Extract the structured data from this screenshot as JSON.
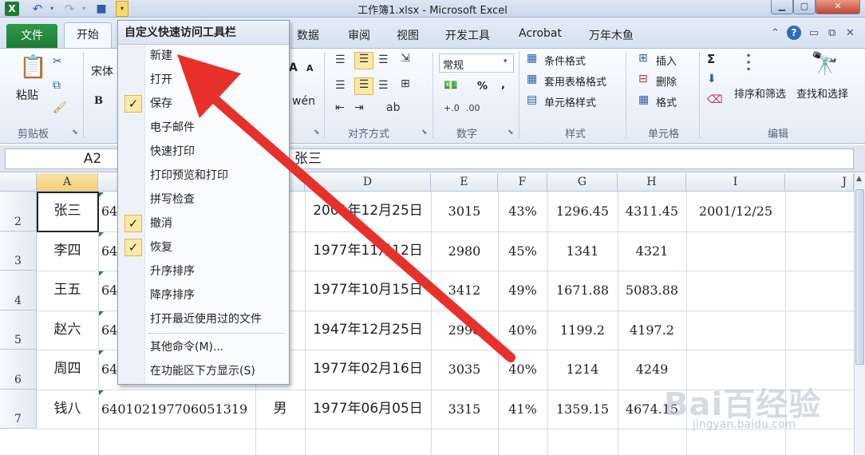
{
  "titlebar": {
    "title": "工作簿1.xlsx  -  Microsoft Excel",
    "icons": [
      "excel-logo",
      "undo-icon",
      "redo-icon",
      "save-icon",
      "customize-dropdown-icon"
    ],
    "window_buttons": {
      "min": "▁",
      "max": "▢",
      "close": "✕"
    }
  },
  "tabs": {
    "file": "文件",
    "home": "开始",
    "others": [
      "数据",
      "审阅",
      "视图",
      "开发工具",
      "Acrobat",
      "万年木鱼"
    ]
  },
  "ribbon": {
    "clipboard": {
      "paste": "粘贴",
      "label": "剪贴板"
    },
    "font": {
      "font_name": "宋体",
      "bold": "B",
      "grow": "A",
      "shrink": "A",
      "phonetic": "wén"
    },
    "alignment": {
      "label": "对齐方式"
    },
    "number": {
      "format": "常规",
      "percent": "%",
      "comma": ",",
      "label": "数字"
    },
    "styles": {
      "conditional": "条件格式",
      "table": "套用表格格式",
      "cell_styles": "单元格样式",
      "label": "样式"
    },
    "cells": {
      "insert": "插入",
      "delete": "删除",
      "format": "格式",
      "label": "单元格"
    },
    "editing": {
      "sigma": "Σ",
      "sort_filter": "排序和筛选",
      "find_select": "查找和选择",
      "label": "编辑"
    }
  },
  "formula_bar": {
    "name_box": "A2",
    "formula": "张三"
  },
  "grid": {
    "columns": [
      "A",
      "B",
      "C",
      "D",
      "E",
      "F",
      "G",
      "H",
      "I",
      "J"
    ],
    "rows": [
      {
        "num": "2",
        "cells": [
          "张三",
          "64",
          "",
          "2001年12月25日",
          "3015",
          "43%",
          "1296.45",
          "4311.45",
          "2001/12/25"
        ]
      },
      {
        "num": "3",
        "cells": [
          "李四",
          "64",
          "",
          "1977年11月12日",
          "2980",
          "45%",
          "1341",
          "4321",
          ""
        ]
      },
      {
        "num": "4",
        "cells": [
          "王五",
          "64",
          "",
          "1977年10月15日",
          "3412",
          "49%",
          "1671.88",
          "5083.88",
          ""
        ]
      },
      {
        "num": "5",
        "cells": [
          "赵六",
          "64",
          "",
          "1947年12月25日",
          "2998",
          "40%",
          "1199.2",
          "4197.2",
          ""
        ]
      },
      {
        "num": "6",
        "cells": [
          "周四",
          "64",
          "",
          "1977年02月16日",
          "3035",
          "40%",
          "1214",
          "4249",
          ""
        ]
      },
      {
        "num": "7",
        "cells": [
          "钱八",
          "640102197706051319",
          "男",
          "1977年06月05日",
          "3315",
          "41%",
          "1359.15",
          "4674.15",
          ""
        ]
      }
    ]
  },
  "qa_menu": {
    "header": "自定义快速访问工具栏",
    "items": [
      {
        "label": "新建",
        "checked": false
      },
      {
        "label": "打开",
        "checked": false
      },
      {
        "label": "保存",
        "checked": true
      },
      {
        "label": "电子邮件",
        "checked": false
      },
      {
        "label": "快速打印",
        "checked": false
      },
      {
        "label": "打印预览和打印",
        "checked": false
      },
      {
        "label": "拼写检查",
        "checked": false
      },
      {
        "label": "撤消",
        "checked": true
      },
      {
        "label": "恢复",
        "checked": true
      },
      {
        "label": "升序排序",
        "checked": false
      },
      {
        "label": "降序排序",
        "checked": false
      },
      {
        "label": "打开最近使用过的文件",
        "checked": false
      },
      {
        "label": "其他命令(M)...",
        "checked": false
      },
      {
        "label": "在功能区下方显示(S)",
        "checked": false
      }
    ]
  },
  "watermark": {
    "logo": "Bai百经验",
    "sub": "jingyan.baidu.com"
  },
  "colors": {
    "arrow": "#e8302a",
    "file_tab": "#1d7a35",
    "check_bg": "#fce9a8"
  }
}
